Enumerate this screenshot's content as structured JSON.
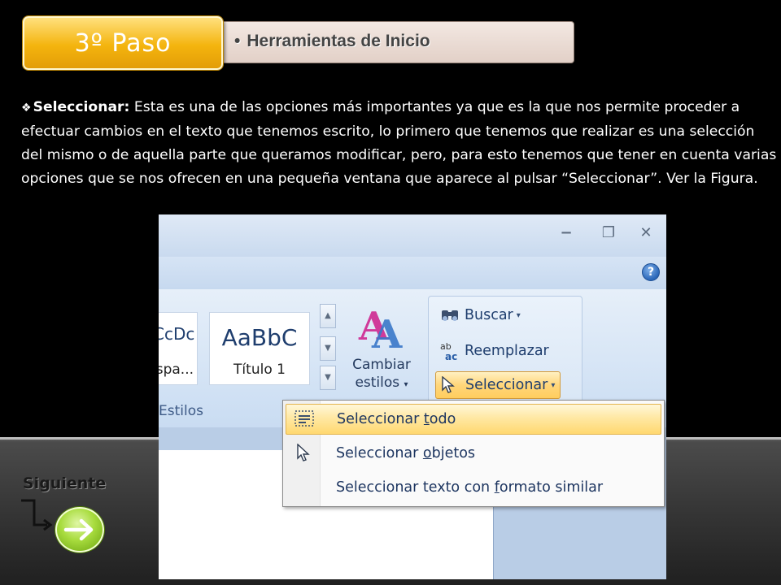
{
  "step": {
    "badge": "3º  Paso",
    "bullet": "•",
    "title": "Herramientas de Inicio"
  },
  "body": {
    "bullet_icon": "diamond-bullet-icon",
    "term": "Seleccionar:",
    "text": " Esta es una de las opciones más importantes ya que es la que nos permite proceder a efectuar cambios en el texto que tenemos escrito, lo primero que tenemos que realizar es una selección del mismo o de aquella parte que queramos modificar, pero, para esto tenemos que tener en cuenta varias opciones que se nos ofrecen en una pequeña ventana que aparece al pulsar “Seleccionar”. Ver la Figura."
  },
  "screenshot": {
    "window_buttons": {
      "minimize": "−",
      "restore": "❐",
      "close": "✕"
    },
    "help": "?",
    "styles_gallery": [
      {
        "sample": "CcDc",
        "name": "spa..."
      },
      {
        "sample": "AaBbC",
        "name": "Título 1"
      }
    ],
    "styles_group_label": "Estilos",
    "change_styles": {
      "line1": "Cambiar",
      "line2": "estilos",
      "caret": "▾"
    },
    "editing": {
      "find": "Buscar",
      "replace": "Reemplazar",
      "select": "Seleccionar",
      "caret": "▾"
    },
    "select_menu": [
      {
        "before": "Seleccionar ",
        "accel": "t",
        "after": "odo",
        "icon": "select-all-icon",
        "highlighted": true
      },
      {
        "before": "Seleccionar ",
        "accel": "o",
        "after": "bjetos",
        "icon": "pointer-icon",
        "highlighted": false
      },
      {
        "before": "Seleccionar texto con ",
        "accel": "f",
        "after": "ormato similar",
        "icon": "",
        "highlighted": false
      }
    ]
  },
  "nav": {
    "next_label": "Siguiente",
    "next_icon": "arrow-right-icon"
  },
  "colors": {
    "badge": "#f4b40e",
    "next_button": "#a8dc3e",
    "menu_highlight": "#ffe8a3"
  }
}
